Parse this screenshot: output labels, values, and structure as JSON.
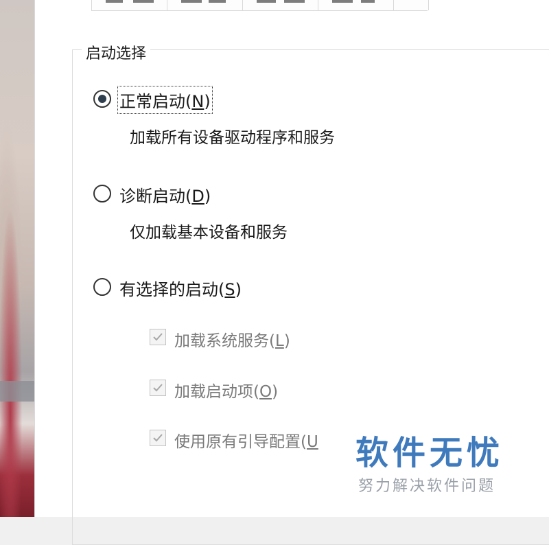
{
  "group": {
    "legend": "启动选择"
  },
  "options": [
    {
      "label_pre": "正常启动(",
      "accel": "N",
      "label_post": ")",
      "description": "加载所有设备驱动程序和服务",
      "checked": true
    },
    {
      "label_pre": "诊断启动(",
      "accel": "D",
      "label_post": ")",
      "description": "仅加载基本设备和服务",
      "checked": false
    },
    {
      "label_pre": "有选择的启动(",
      "accel": "S",
      "label_post": ")",
      "checked": false
    }
  ],
  "sub_options": [
    {
      "label_pre": "加载系统服务(",
      "accel": "L",
      "label_post": ")",
      "checked": true,
      "enabled": false
    },
    {
      "label_pre": "加载启动项(",
      "accel": "O",
      "label_post": ")",
      "checked": true,
      "enabled": false
    },
    {
      "label_pre": "使用原有引导配置(",
      "accel": "U",
      "label_post": "",
      "checked": true,
      "enabled": false
    }
  ],
  "watermark": {
    "title": "软件无忧",
    "subtitle": "努力解决软件问题",
    "color": "#2f6fb8"
  },
  "colors": {
    "radio_dot": "#2e3e4c",
    "disabled_text": "#7a7a7a"
  }
}
